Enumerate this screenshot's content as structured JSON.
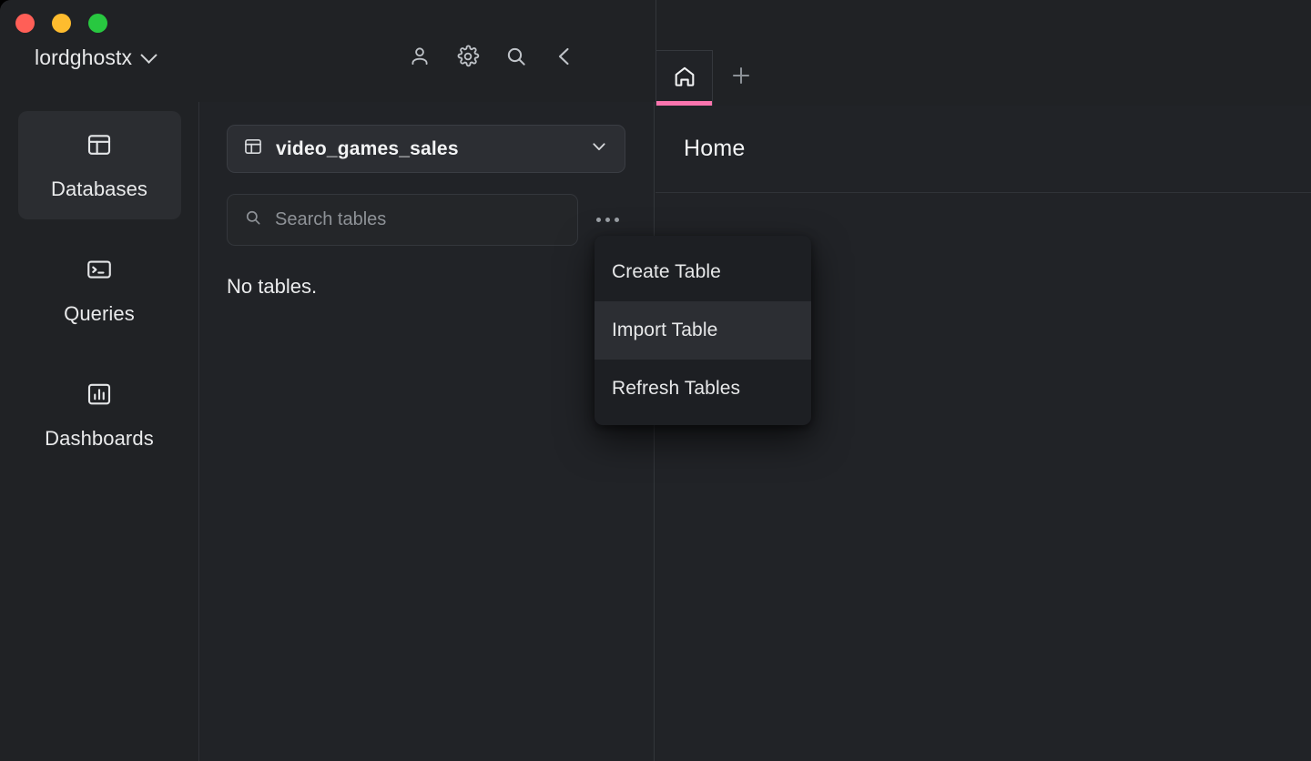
{
  "window": {
    "traffic_lights": [
      {
        "name": "close",
        "color": "#FF5F57"
      },
      {
        "name": "minimize",
        "color": "#FEBC2E"
      },
      {
        "name": "maximize",
        "color": "#28C840"
      }
    ]
  },
  "titlebar": {
    "workspace": "lordghostx",
    "workspace_chevron": "chevron-down-icon",
    "actions": [
      {
        "name": "account-icon",
        "label": "Account"
      },
      {
        "name": "settings-icon",
        "label": "Settings"
      },
      {
        "name": "search-icon",
        "label": "Search"
      },
      {
        "name": "back-icon",
        "label": "Back"
      }
    ]
  },
  "tabstrip": {
    "tabs": [
      {
        "name": "home-icon",
        "label": "Home",
        "active": true
      }
    ],
    "new_tab_label": "New tab",
    "active_indicator_color": "#FA74AE"
  },
  "sidebar": {
    "items": [
      {
        "label": "Databases",
        "icon": "layout-panel-icon",
        "active": true
      },
      {
        "label": "Queries",
        "icon": "terminal-icon",
        "active": false
      },
      {
        "label": "Dashboards",
        "icon": "bar-chart-icon",
        "active": false
      }
    ]
  },
  "tables_panel": {
    "database": {
      "name": "video_games_sales",
      "icon": "layout-panel-icon",
      "chevron": "chevron-down-icon"
    },
    "search": {
      "placeholder": "Search tables",
      "value": "",
      "icon": "search-icon"
    },
    "more_button": "ellipsis-icon",
    "empty_state": "No tables."
  },
  "context_menu": {
    "items": [
      {
        "label": "Create Table",
        "highlighted": false
      },
      {
        "label": "Import Table",
        "highlighted": true
      },
      {
        "label": "Refresh Tables",
        "highlighted": false
      }
    ]
  },
  "main": {
    "title": "Home"
  }
}
